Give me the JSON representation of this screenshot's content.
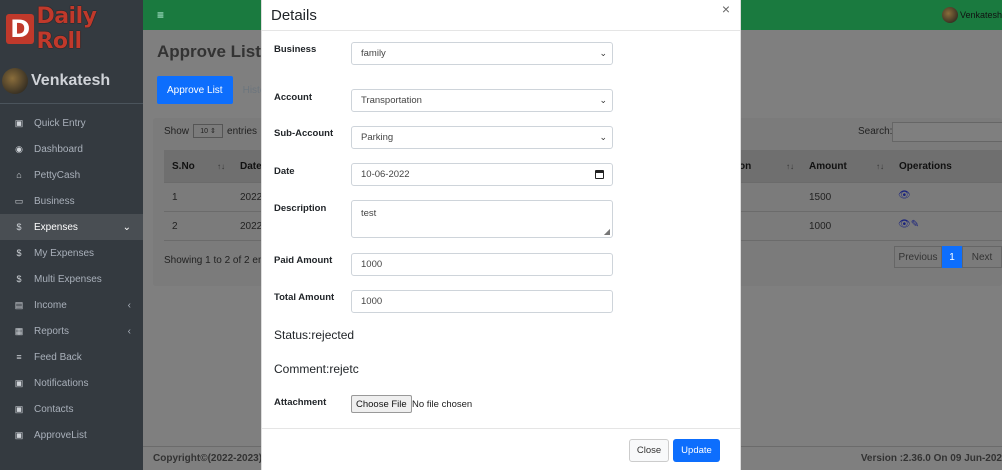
{
  "brand": {
    "logo_letter": "D",
    "name": "Daily Roll"
  },
  "user": {
    "name": "Venkatesh",
    "top_name": "Venkatesh"
  },
  "sidebar": {
    "items": [
      {
        "label": "Quick Entry",
        "icon": "▣"
      },
      {
        "label": "Dashboard",
        "icon": "◉"
      },
      {
        "label": "PettyCash",
        "icon": "⌂"
      },
      {
        "label": "Business",
        "icon": "▭"
      },
      {
        "label": "Expenses",
        "icon": "$",
        "chevron": "⌄"
      },
      {
        "label": "My Expenses",
        "icon": "$"
      },
      {
        "label": "Multi Expenses",
        "icon": "$"
      },
      {
        "label": "Income",
        "icon": "▤",
        "chevron": "‹"
      },
      {
        "label": "Reports",
        "icon": "▦",
        "chevron": "‹"
      },
      {
        "label": "Feed Back",
        "icon": "≡"
      },
      {
        "label": "Notifications",
        "icon": "▣"
      },
      {
        "label": "Contacts",
        "icon": "▣"
      },
      {
        "label": "ApproveList",
        "icon": "▣"
      }
    ]
  },
  "topbar": {
    "menu_icon": "≡"
  },
  "page": {
    "title": "Approve List",
    "tab_active": "Approve List",
    "tab_other": "Histo",
    "show_label": "Show",
    "show_value": "10",
    "entries_label": "entries",
    "search_label": "Search:",
    "columns": [
      "S.No",
      "Date",
      "on",
      "Amount",
      "Operations"
    ],
    "rows": [
      {
        "sno": "1",
        "date": "2022",
        "amount": "1500",
        "ops": "👁"
      },
      {
        "sno": "2",
        "date": "2022",
        "amount": "1000",
        "ops": "👁✎"
      }
    ],
    "showing": "Showing 1 to 2 of 2 en",
    "pager": {
      "prev": "Previous",
      "current": "1",
      "next": "Next"
    }
  },
  "footer": {
    "copyright": "Copyright©(2022-2023)",
    "version": "Version :2.36.0 On 09 Jun-202"
  },
  "modal": {
    "title": "Details",
    "close_symbol": "×",
    "fields": {
      "business_label": "Business",
      "business_value": "family",
      "account_label": "Account",
      "account_value": "Transportation",
      "subaccount_label": "Sub-Account",
      "subaccount_value": "Parking",
      "date_label": "Date",
      "date_value": "10-06-2022",
      "description_label": "Description",
      "description_value": "test",
      "paid_label": "Paid Amount",
      "paid_value": "1000",
      "total_label": "Total Amount",
      "total_value": "1000"
    },
    "status": "Status:rejected",
    "comment": "Comment:rejetc",
    "attachment_label": "Attachment",
    "file_button": "Choose File",
    "file_status": "No file chosen",
    "close_label": "Close",
    "update_label": "Update"
  }
}
